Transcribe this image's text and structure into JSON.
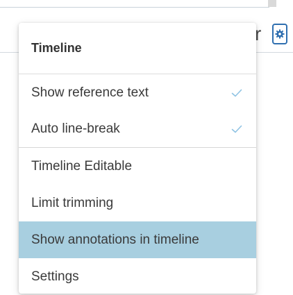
{
  "background": {
    "fragment_text": "r",
    "gear_icon": "gear-icon"
  },
  "menu": {
    "title": "Timeline",
    "items": [
      {
        "label": "Show reference text",
        "checked": true
      },
      {
        "label": "Auto line-break",
        "checked": true
      },
      {
        "label": "Timeline Editable",
        "checked": false
      },
      {
        "label": "Limit trimming",
        "checked": false
      },
      {
        "label": "Show annotations in timeline",
        "checked": false,
        "highlighted": true
      },
      {
        "label": "Settings",
        "checked": false
      }
    ]
  },
  "colors": {
    "accent": "#2f6fb0",
    "highlight": "#a8cfe0",
    "check": "#8fc3e3"
  }
}
